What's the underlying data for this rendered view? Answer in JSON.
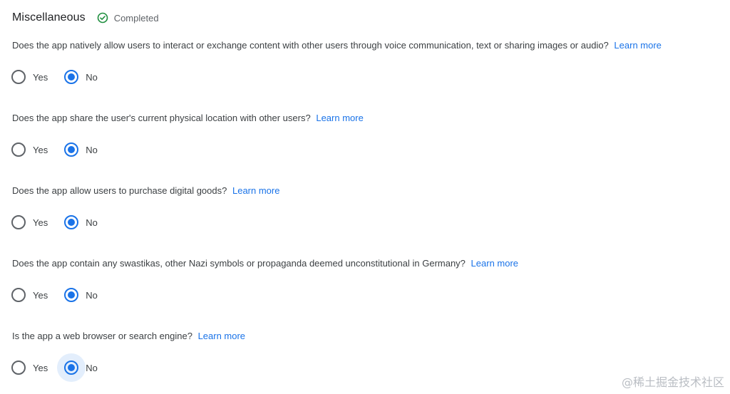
{
  "section": {
    "title": "Miscellaneous",
    "status": "Completed",
    "status_color": "#1e8e3e"
  },
  "learn_more": "Learn more",
  "questions": [
    {
      "text": "Does the app natively allow users to interact or exchange content with other users through voice communication, text or sharing images or audio?",
      "options": [
        {
          "label": "Yes",
          "checked": false
        },
        {
          "label": "No",
          "checked": true
        }
      ]
    },
    {
      "text": "Does the app share the user's current physical location with other users?",
      "options": [
        {
          "label": "Yes",
          "checked": false
        },
        {
          "label": "No",
          "checked": true
        }
      ]
    },
    {
      "text": "Does the app allow users to purchase digital goods?",
      "options": [
        {
          "label": "Yes",
          "checked": false
        },
        {
          "label": "No",
          "checked": true
        }
      ]
    },
    {
      "text": "Does the app contain any swastikas, other Nazi symbols or propaganda deemed unconstitutional in Germany?",
      "options": [
        {
          "label": "Yes",
          "checked": false
        },
        {
          "label": "No",
          "checked": true
        }
      ]
    },
    {
      "text": "Is the app a web browser or search engine?",
      "options": [
        {
          "label": "Yes",
          "checked": false
        },
        {
          "label": "No",
          "checked": true,
          "focused": true
        }
      ]
    }
  ],
  "watermark": "@稀土掘金技术社区",
  "accent_color": "#1a73e8",
  "icons": {
    "status": "check-circle-icon"
  }
}
